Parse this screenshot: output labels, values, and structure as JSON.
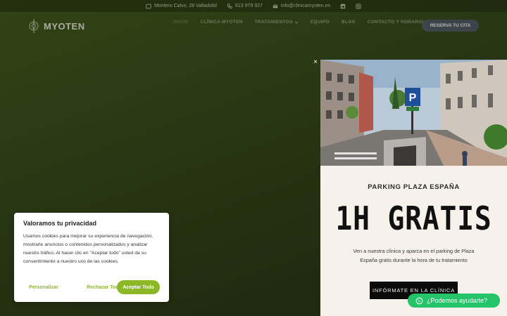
{
  "topbar": {
    "address": "Montero Calvo, 28 Valladolid",
    "phone": "613 979 927",
    "email": "info@clinicamyoten.es"
  },
  "header": {
    "logo_text": "MYOTEN",
    "nav": [
      "INICIO",
      "CLÍNICA MYOTEN",
      "TRATAMIENTOS",
      "EQUIPO",
      "BLOG",
      "CONTACTO Y HORARIO"
    ],
    "book_label": "RESERVA TU CITA"
  },
  "popup": {
    "close": "×",
    "subtitle": "PARKING PLAZA ESPAÑA",
    "headline": "1H GRATIS",
    "body": "Ven a nuestra clínica y aparca en el parking de Plaza España gratis durante la hora de tu tratamiento",
    "cta": "INFÓRMATE EN LA CLÍNICA",
    "photo_sign": "P"
  },
  "cookie": {
    "title": "Valoramos tu privacidad",
    "text": "Usamos cookies para mejorar su experiencia de navegación, mostrarle anuncios o contenidos personalizados y analizar nuestro tráfico. Al hacer clic en \"Aceptar todo\" usted da su consentimiento a nuestro uso de las cookies.",
    "customize": "Personalizar",
    "reject": "Rechazar Todo",
    "accept": "Aceptar Todo"
  },
  "whatsapp": {
    "label": "¿Podemos ayudarte?"
  },
  "colors": {
    "accent_green": "#8cb828",
    "whatsapp_green": "#25c46a",
    "popup_bg": "#f6f1ea",
    "book_button": "#4a5060"
  }
}
